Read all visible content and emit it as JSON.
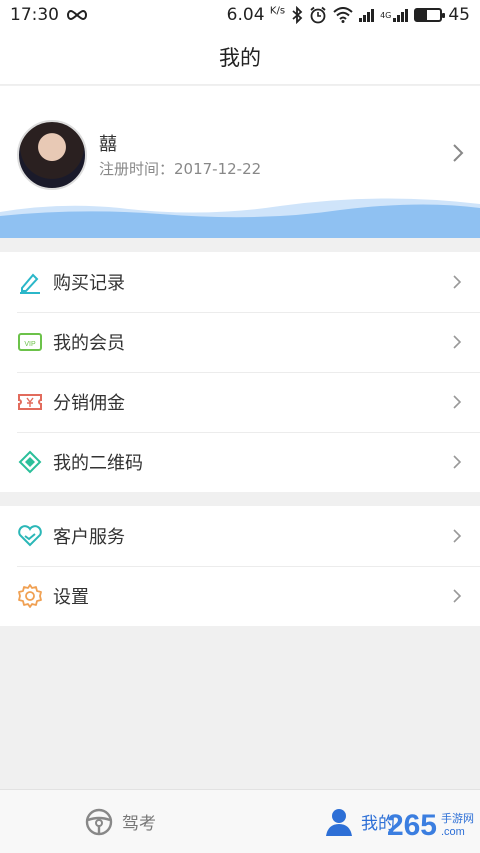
{
  "status_bar": {
    "time": "17:30",
    "speed": "6.04",
    "speed_unit": "K/s",
    "network_label": "4G",
    "battery": "45"
  },
  "header": {
    "title": "我的"
  },
  "profile": {
    "name": "囍",
    "register_date": "注册时间：2017-12-22"
  },
  "menu_group_1": [
    {
      "label": "购买记录",
      "icon": "pen-icon",
      "color": "#2bb7c9"
    },
    {
      "label": "我的会员",
      "icon": "vip-card-icon",
      "color": "#6cc24a"
    },
    {
      "label": "分销佣金",
      "icon": "ticket-icon",
      "color": "#e26b5c"
    },
    {
      "label": "我的二维码",
      "icon": "qr-code-icon",
      "color": "#2bbf9a"
    }
  ],
  "menu_group_2": [
    {
      "label": "客户服务",
      "icon": "heart-handshake-icon",
      "color": "#2bb7b7"
    },
    {
      "label": "设置",
      "icon": "gear-icon",
      "color": "#f0a052"
    }
  ],
  "bottom_nav": [
    {
      "label": "驾考",
      "icon": "steering-wheel-icon",
      "active": false
    },
    {
      "label": "我的",
      "icon": "user-icon",
      "active": true
    }
  ],
  "watermark": {
    "number": "265",
    "text_top": "手游网",
    "text_bottom": ".com"
  },
  "colors": {
    "accent": "#2d6fd6",
    "wave": "#8fc1f2"
  }
}
